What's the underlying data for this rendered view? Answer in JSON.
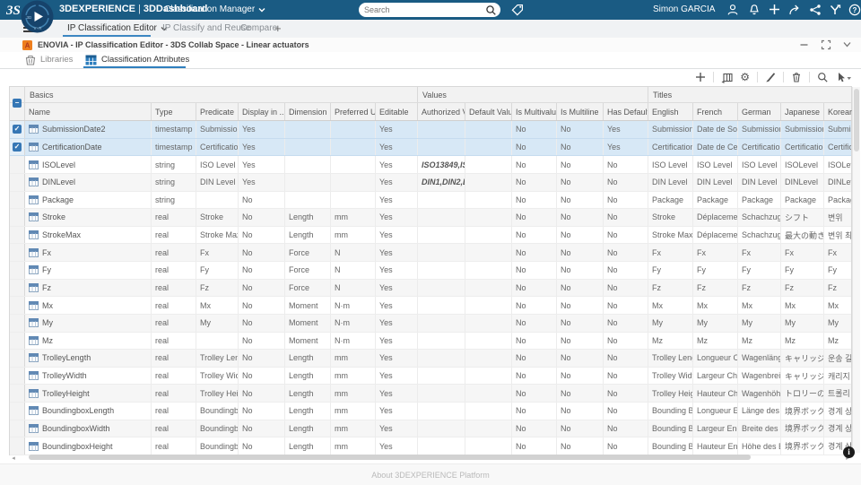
{
  "topbar": {
    "brand_platform": "3DEXPERIENCE",
    "brand_separator": "|",
    "brand_app": "3DDashboard",
    "app_menu_label": "Classification Manager",
    "search_placeholder": "Search",
    "user": "Simon GARCIA"
  },
  "tabs": {
    "items": [
      "IP Classification Editor",
      "IP Classify and Reuse",
      "Compare"
    ],
    "add_label": "+"
  },
  "window": {
    "title": "ENOVIA - IP Classification Editor - 3DS Collab Space - Linear actuators",
    "subtabs": [
      {
        "label": "Libraries"
      },
      {
        "label": "Classification Attributes"
      }
    ]
  },
  "footer": {
    "about": "About 3DEXPERIENCE Platform"
  },
  "icons": {
    "check": "✓",
    "indeterminate": "−",
    "sort": "⇅",
    "gear": "⚙",
    "plus": "+",
    "tab_plus": "+",
    "minimize": "−",
    "scroll_left": "◂",
    "scroll_right": "▸",
    "info": "i"
  },
  "colors": {
    "topbar": "#1A5B83",
    "accent": "#2F7FBE",
    "selected_row": "#D7E8F6",
    "checkbox": "#3677B5",
    "enovia_orange": "#EE7F1F"
  },
  "table": {
    "groups": [
      "Basics",
      "Values",
      "Titles"
    ],
    "columns": [
      "Name",
      "Type",
      "Predicate",
      "Display in ...",
      "Dimension",
      "Preferred Unit",
      "Editable",
      "Authorized Val...",
      "Default Value (...",
      "Is Multivalue",
      "Is Multiline",
      "Has Default Va...",
      "English",
      "French",
      "German",
      "Japanese",
      "Korean"
    ],
    "rows": [
      {
        "checked": true,
        "name": "SubmissionDate2",
        "type": "timestamp",
        "predicate": "Submission Date",
        "display": "Yes",
        "dimension": "",
        "unit": "",
        "editable": "Yes",
        "authorized": "",
        "default_value": "",
        "multivalue": "No",
        "multiline": "No",
        "has_default": "Yes",
        "title_en": "Submission Date",
        "title_fr": "Date de Soum...",
        "title_de": "Submission Date",
        "title_ja": "Submission Date",
        "title_ko": "Submission"
      },
      {
        "checked": true,
        "name": "CertificationDate",
        "type": "timestamp",
        "predicate": "Certification D...",
        "display": "Yes",
        "dimension": "",
        "unit": "",
        "editable": "Yes",
        "authorized": "",
        "default_value": "",
        "multivalue": "No",
        "multiline": "No",
        "has_default": "Yes",
        "title_en": "Certification D...",
        "title_fr": "Date de Certifi...",
        "title_de": "Certification D...",
        "title_ja": "Certification D...",
        "title_ko": "Certification"
      },
      {
        "checked": false,
        "name": "ISOLevel",
        "type": "string",
        "predicate": "ISO Level",
        "display": "Yes",
        "dimension": "",
        "unit": "",
        "editable": "Yes",
        "authorized": "ISO13849,IS...",
        "default_value": "",
        "multivalue": "No",
        "multiline": "No",
        "has_default": "No",
        "title_en": "ISO Level",
        "title_fr": "ISO Level",
        "title_de": "ISO Level",
        "title_ja": "ISOLevel",
        "title_ko": "ISOLevel"
      },
      {
        "checked": false,
        "name": "DINLevel",
        "type": "string",
        "predicate": "DIN Level",
        "display": "Yes",
        "dimension": "",
        "unit": "",
        "editable": "Yes",
        "authorized": "DIN1,DIN2,D...",
        "default_value": "",
        "multivalue": "No",
        "multiline": "No",
        "has_default": "No",
        "title_en": "DIN Level",
        "title_fr": "DIN Level",
        "title_de": "DIN Level",
        "title_ja": "DINLevel",
        "title_ko": "DINLevel"
      },
      {
        "checked": false,
        "name": "Package",
        "type": "string",
        "predicate": "",
        "display": "No",
        "dimension": "",
        "unit": "",
        "editable": "Yes",
        "authorized": "",
        "default_value": "",
        "multivalue": "No",
        "multiline": "No",
        "has_default": "No",
        "title_en": "Package",
        "title_fr": "Package",
        "title_de": "Package",
        "title_ja": "Package",
        "title_ko": "Package"
      },
      {
        "checked": false,
        "name": "Stroke",
        "type": "real",
        "predicate": "Stroke",
        "display": "No",
        "dimension": "Length",
        "unit": "mm",
        "editable": "Yes",
        "authorized": "",
        "default_value": "",
        "multivalue": "No",
        "multiline": "No",
        "has_default": "No",
        "title_en": "Stroke",
        "title_fr": "Déplacement",
        "title_de": "Schachzug",
        "title_ja": "シフト",
        "title_ko": "변위"
      },
      {
        "checked": false,
        "name": "StrokeMax",
        "type": "real",
        "predicate": "Stroke Max",
        "display": "No",
        "dimension": "Length",
        "unit": "mm",
        "editable": "Yes",
        "authorized": "",
        "default_value": "",
        "multivalue": "No",
        "multiline": "No",
        "has_default": "No",
        "title_en": "Stroke Max.",
        "title_fr": "Déplacement ...",
        "title_de": "Schachzug max.",
        "title_ja": "最大の動き",
        "title_ko": "변위 최대"
      },
      {
        "checked": false,
        "name": "Fx",
        "type": "real",
        "predicate": "Fx",
        "display": "No",
        "dimension": "Force",
        "unit": "N",
        "editable": "Yes",
        "authorized": "",
        "default_value": "",
        "multivalue": "No",
        "multiline": "No",
        "has_default": "No",
        "title_en": "Fx",
        "title_fr": "Fx",
        "title_de": "Fx",
        "title_ja": "Fx",
        "title_ko": "Fx"
      },
      {
        "checked": false,
        "name": "Fy",
        "type": "real",
        "predicate": "Fy",
        "display": "No",
        "dimension": "Force",
        "unit": "N",
        "editable": "Yes",
        "authorized": "",
        "default_value": "",
        "multivalue": "No",
        "multiline": "No",
        "has_default": "No",
        "title_en": "Fy",
        "title_fr": "Fy",
        "title_de": "Fy",
        "title_ja": "Fy",
        "title_ko": "Fy"
      },
      {
        "checked": false,
        "name": "Fz",
        "type": "real",
        "predicate": "Fz",
        "display": "No",
        "dimension": "Force",
        "unit": "N",
        "editable": "Yes",
        "authorized": "",
        "default_value": "",
        "multivalue": "No",
        "multiline": "No",
        "has_default": "No",
        "title_en": "Fz",
        "title_fr": "Fz",
        "title_de": "Fz",
        "title_ja": "Fz",
        "title_ko": "Fz"
      },
      {
        "checked": false,
        "name": "Mx",
        "type": "real",
        "predicate": "Mx",
        "display": "No",
        "dimension": "Moment",
        "unit": "N·m",
        "editable": "Yes",
        "authorized": "",
        "default_value": "",
        "multivalue": "No",
        "multiline": "No",
        "has_default": "No",
        "title_en": "Mx",
        "title_fr": "Mx",
        "title_de": "Mx",
        "title_ja": "Mx",
        "title_ko": "Mx"
      },
      {
        "checked": false,
        "name": "My",
        "type": "real",
        "predicate": "My",
        "display": "No",
        "dimension": "Moment",
        "unit": "N·m",
        "editable": "Yes",
        "authorized": "",
        "default_value": "",
        "multivalue": "No",
        "multiline": "No",
        "has_default": "No",
        "title_en": "My",
        "title_fr": "My",
        "title_de": "My",
        "title_ja": "My",
        "title_ko": "My"
      },
      {
        "checked": false,
        "name": "Mz",
        "type": "real",
        "predicate": "",
        "display": "No",
        "dimension": "Moment",
        "unit": "N·m",
        "editable": "Yes",
        "authorized": "",
        "default_value": "",
        "multivalue": "No",
        "multiline": "No",
        "has_default": "No",
        "title_en": "Mz",
        "title_fr": "Mz",
        "title_de": "Mz",
        "title_ja": "Mz",
        "title_ko": "Mz"
      },
      {
        "checked": false,
        "name": "TrolleyLength",
        "type": "real",
        "predicate": "Trolley Length",
        "display": "No",
        "dimension": "Length",
        "unit": "mm",
        "editable": "Yes",
        "authorized": "",
        "default_value": "",
        "multivalue": "No",
        "multiline": "No",
        "has_default": "No",
        "title_en": "Trolley Length",
        "title_fr": "Longueur Cha...",
        "title_de": "Wagenlänge",
        "title_ja": "キャリッジの...",
        "title_ko": "운송 길이"
      },
      {
        "checked": false,
        "name": "TrolleyWidth",
        "type": "real",
        "predicate": "Trolley Width",
        "display": "No",
        "dimension": "Length",
        "unit": "mm",
        "editable": "Yes",
        "authorized": "",
        "default_value": "",
        "multivalue": "No",
        "multiline": "No",
        "has_default": "No",
        "title_en": "Trolley Width",
        "title_fr": "Largeur Chariot",
        "title_de": "Wagenbreite",
        "title_ja": "キャリッジ幅",
        "title_ko": "캐리지 폭"
      },
      {
        "checked": false,
        "name": "TrolleyHeight",
        "type": "real",
        "predicate": "Trolley Height",
        "display": "No",
        "dimension": "Length",
        "unit": "mm",
        "editable": "Yes",
        "authorized": "",
        "default_value": "",
        "multivalue": "No",
        "multiline": "No",
        "has_default": "No",
        "title_en": "Trolley Height",
        "title_fr": "Hauteur Chariot",
        "title_de": "Wagenhöhe",
        "title_ja": "トロリーの高さ",
        "title_ko": "트롤리 높이"
      },
      {
        "checked": false,
        "name": "BoundingboxLength",
        "type": "real",
        "predicate": "Boundingbox ...",
        "display": "No",
        "dimension": "Length",
        "unit": "mm",
        "editable": "Yes",
        "authorized": "",
        "default_value": "",
        "multivalue": "No",
        "multiline": "No",
        "has_default": "No",
        "title_en": "Bounding Box ...",
        "title_fr": "Longueur Enc...",
        "title_de": "Länge des Be...",
        "title_ja": "境界ボックス...",
        "title_ko": "경계 상자 길"
      },
      {
        "checked": false,
        "name": "BoundingboxWidth",
        "type": "real",
        "predicate": "Boundingbox ...",
        "display": "No",
        "dimension": "Length",
        "unit": "mm",
        "editable": "Yes",
        "authorized": "",
        "default_value": "",
        "multivalue": "No",
        "multiline": "No",
        "has_default": "No",
        "title_en": "Bounding Box ...",
        "title_fr": "Largeur Enco...",
        "title_de": "Breite des Beg...",
        "title_ja": "境界ボックス...",
        "title_ko": "경계 상자 너"
      },
      {
        "checked": false,
        "name": "BoundingboxHeight",
        "type": "real",
        "predicate": "Boundingbox ...",
        "display": "No",
        "dimension": "Length",
        "unit": "mm",
        "editable": "Yes",
        "authorized": "",
        "default_value": "",
        "multivalue": "No",
        "multiline": "No",
        "has_default": "No",
        "title_en": "Bounding Box ...",
        "title_fr": "Hauteur Enco...",
        "title_de": "Höhe des Beg...",
        "title_ja": "境界ボックス...",
        "title_ko": "경계 상자 높"
      }
    ]
  }
}
